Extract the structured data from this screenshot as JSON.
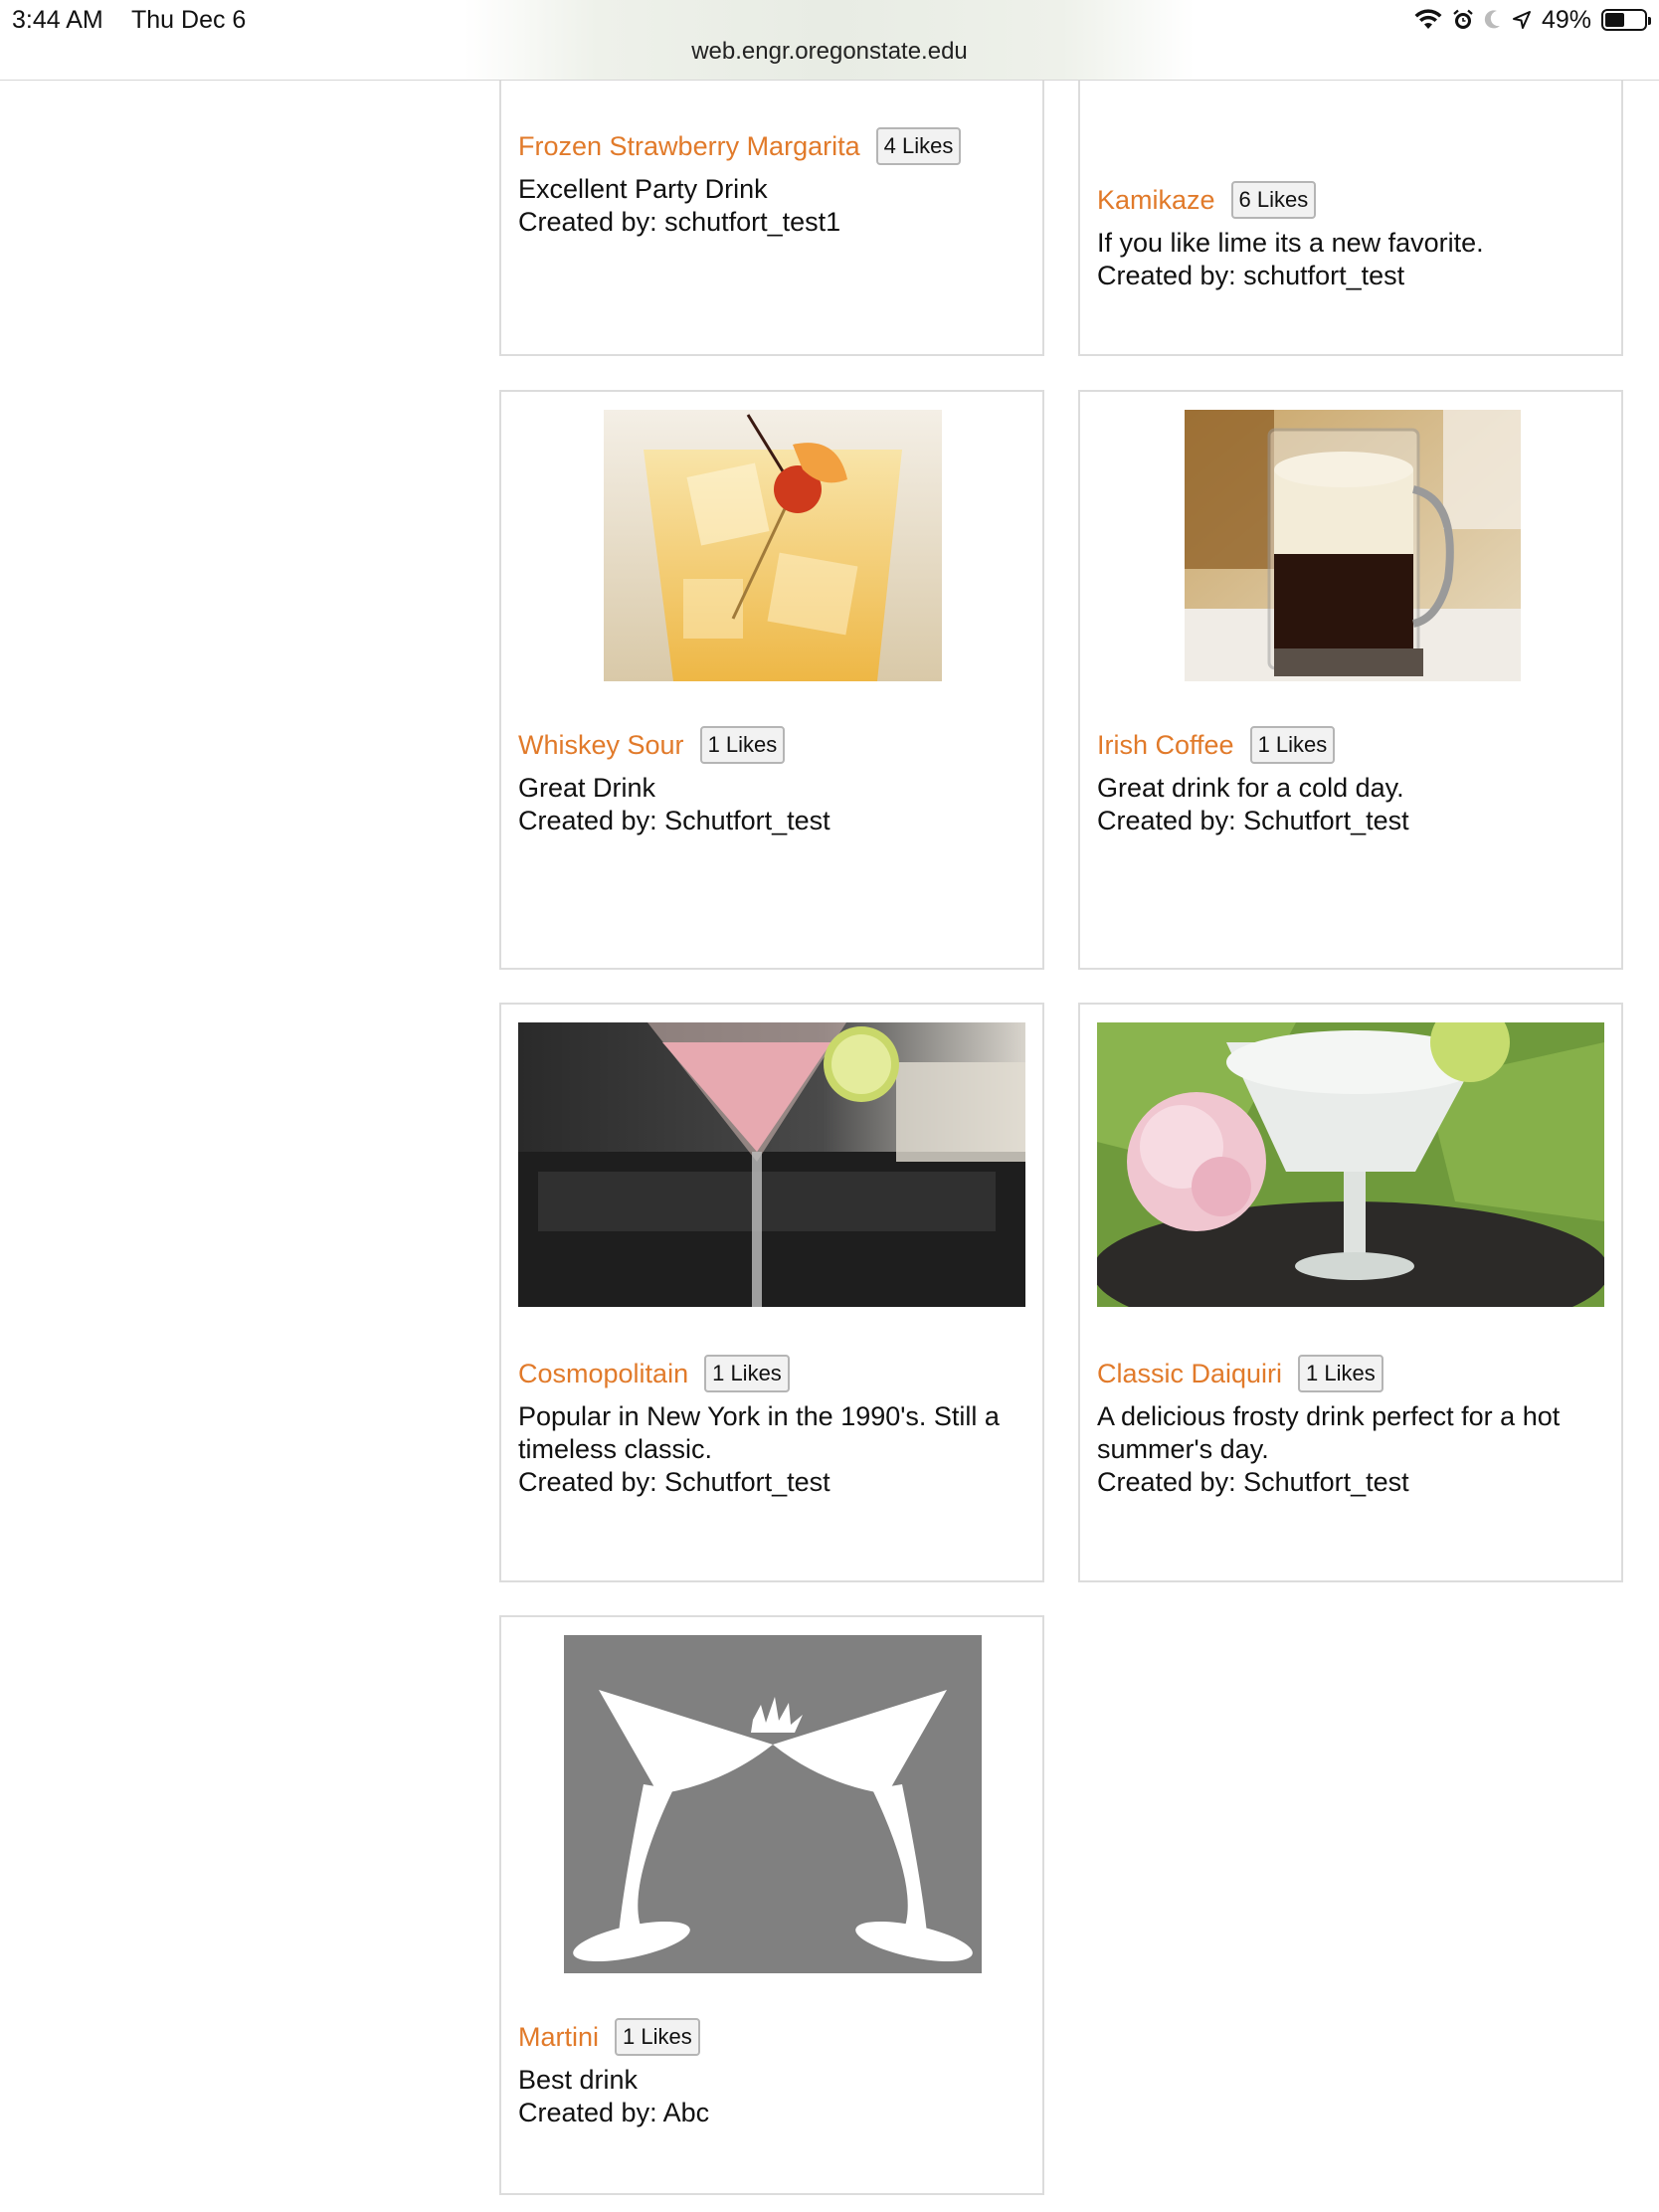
{
  "status": {
    "time": "3:44 AM",
    "date": "Thu Dec 6",
    "battery": "49%",
    "battery_level": 0.49
  },
  "browser": {
    "url": "web.engr.oregonstate.edu"
  },
  "drinks": [
    {
      "name": "Frozen Strawberry Margarita",
      "likes": "4 Likes",
      "description": "Excellent Party Drink",
      "creator": "Created by: schutfort_test1"
    },
    {
      "name": "Kamikaze",
      "likes": "6 Likes",
      "description": "If you like lime its a new favorite.",
      "creator": "Created by: schutfort_test"
    },
    {
      "name": "Whiskey Sour",
      "likes": "1 Likes",
      "description": "Great Drink",
      "creator": "Created by: Schutfort_test"
    },
    {
      "name": "Irish Coffee",
      "likes": "1 Likes",
      "description": "Great drink for a cold day.",
      "creator": "Created by: Schutfort_test"
    },
    {
      "name": "Cosmopolitain",
      "likes": "1 Likes",
      "description": "Popular in New York in the 1990's. Still a timeless classic.",
      "creator": "Created by: Schutfort_test"
    },
    {
      "name": "Classic Daiquiri",
      "likes": "1 Likes",
      "description": "A delicious frosty drink perfect for a hot summer's day.",
      "creator": "Created by: Schutfort_test"
    },
    {
      "name": "Martini",
      "likes": "1 Likes",
      "description": "Best drink",
      "creator": "Created by: Abc"
    }
  ]
}
